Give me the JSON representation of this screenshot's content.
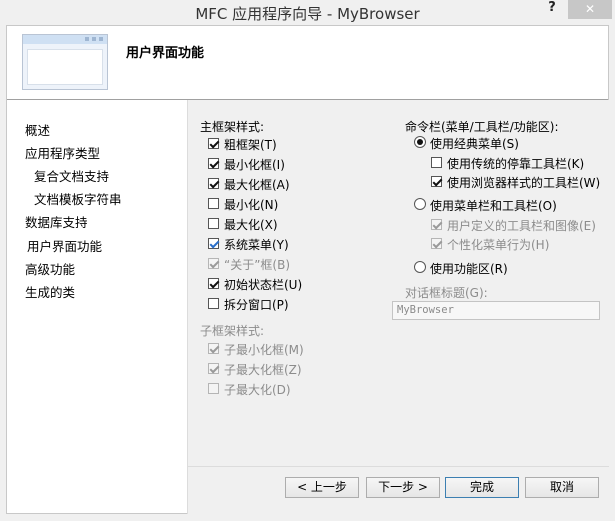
{
  "window": {
    "title": "MFC 应用程序向导 - MyBrowser",
    "help_label": "?",
    "close_label": "✕"
  },
  "header": {
    "page_title": "用户界面功能"
  },
  "nav": {
    "items": [
      {
        "label": "概述"
      },
      {
        "label": "应用程序类型"
      },
      {
        "label": "复合文档支持"
      },
      {
        "label": "文档模板字符串"
      },
      {
        "label": "数据库支持"
      },
      {
        "label": "用户界面功能"
      },
      {
        "label": "高级功能"
      },
      {
        "label": "生成的类"
      }
    ]
  },
  "main_frame": {
    "label": "主框架样式:",
    "options": [
      {
        "label": "粗框架(T)",
        "checked": true,
        "enabled": true
      },
      {
        "label": "最小化框(I)",
        "checked": true,
        "enabled": true
      },
      {
        "label": "最大化框(A)",
        "checked": true,
        "enabled": true
      },
      {
        "label": "最小化(N)",
        "checked": false,
        "enabled": true
      },
      {
        "label": "最大化(X)",
        "checked": false,
        "enabled": true
      },
      {
        "label": "系统菜单(Y)",
        "checked": true,
        "enabled": true
      },
      {
        "label": "“关于”框(B)",
        "checked": true,
        "enabled": false
      },
      {
        "label": "初始状态栏(U)",
        "checked": true,
        "enabled": true
      },
      {
        "label": "拆分窗口(P)",
        "checked": false,
        "enabled": true
      }
    ]
  },
  "child_frame": {
    "label": "子框架样式:",
    "options": [
      {
        "label": "子最小化框(M)",
        "checked": true,
        "enabled": false
      },
      {
        "label": "子最大化框(Z)",
        "checked": true,
        "enabled": false
      },
      {
        "label": "子最大化(D)",
        "checked": false,
        "enabled": false
      }
    ]
  },
  "command_bar": {
    "label": "命令栏(菜单/工具栏/功能区):",
    "classic_menu": {
      "label": "使用经典菜单(S)",
      "selected": true
    },
    "classic_options": [
      {
        "label": "使用传统的停靠工具栏(K)",
        "checked": false,
        "enabled": true
      },
      {
        "label": "使用浏览器样式的工具栏(W)",
        "checked": true,
        "enabled": true
      }
    ],
    "menubar_toolbar": {
      "label": "使用菜单栏和工具栏(O)",
      "selected": false
    },
    "menubar_options": [
      {
        "label": "用户定义的工具栏和图像(E)",
        "checked": true,
        "enabled": false
      },
      {
        "label": "个性化菜单行为(H)",
        "checked": true,
        "enabled": false
      }
    ],
    "ribbon": {
      "label": "使用功能区(R)",
      "selected": false
    }
  },
  "dialog_title": {
    "label": "对话框标题(G):",
    "value": "MyBrowser"
  },
  "buttons": {
    "prev": "< 上一步",
    "next": "下一步 >",
    "finish": "完成",
    "cancel": "取消"
  }
}
